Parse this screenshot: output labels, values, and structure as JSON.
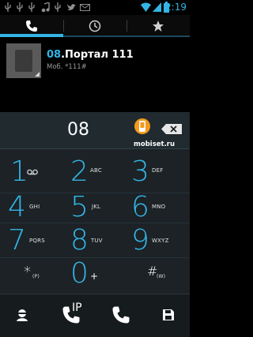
{
  "status_bar": {
    "time": "2:19",
    "icons": [
      "usb-icon",
      "usb-icon",
      "music-icon",
      "usb-icon",
      "twitter-icon",
      "mail-icon",
      "wifi-icon",
      "signal-icon",
      "battery-icon"
    ]
  },
  "tabs": [
    {
      "name": "phone",
      "icon": "phone-icon",
      "selected": true
    },
    {
      "name": "recent",
      "icon": "clock-icon",
      "selected": false
    },
    {
      "name": "favorites",
      "icon": "star-icon",
      "selected": false
    }
  ],
  "result": {
    "name_highlight": "08",
    "name_rest": ".Портал 111",
    "subtitle": "Моб. *111#"
  },
  "dialer": {
    "digits": "08",
    "watermark": "mobiset.ru"
  },
  "keys": [
    {
      "num": "1",
      "letters": ""
    },
    {
      "num": "2",
      "letters": "ABC"
    },
    {
      "num": "3",
      "letters": "DEF"
    },
    {
      "num": "4",
      "letters": "GHI"
    },
    {
      "num": "5",
      "letters": "JKL"
    },
    {
      "num": "6",
      "letters": "MNO"
    },
    {
      "num": "7",
      "letters": "PQRS"
    },
    {
      "num": "8",
      "letters": "TUV"
    },
    {
      "num": "9",
      "letters": "WXYZ"
    },
    {
      "num": "*",
      "letters": "(P)"
    },
    {
      "num": "0",
      "letters": "+"
    },
    {
      "num": "#",
      "letters": "(W)"
    }
  ],
  "bottom_bar": {
    "ip_label": "IP"
  },
  "colors": {
    "accent": "#33b5e5",
    "badge": "#f29a1c"
  }
}
